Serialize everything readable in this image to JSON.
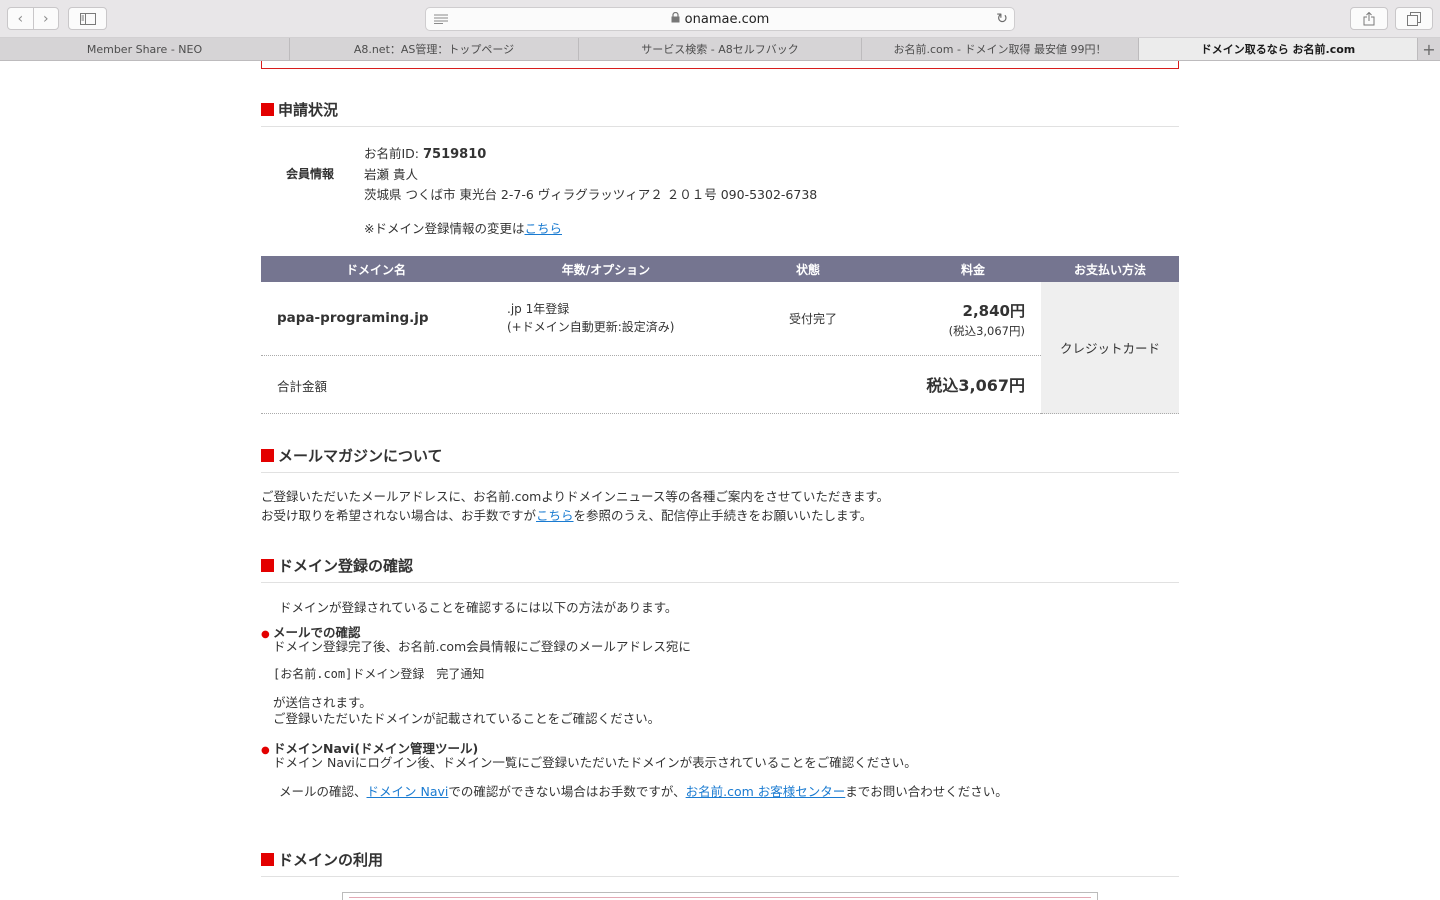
{
  "browser": {
    "url": "onamae.com",
    "tabs": [
      {
        "label": "Member Share - NEO"
      },
      {
        "label": "A8.net：AS管理：トップページ"
      },
      {
        "label": "サービス検索 - A8セルフバック"
      },
      {
        "label": "お名前.com - ドメイン取得 最安値 99円！"
      },
      {
        "label": "ドメイン取るなら お名前.com"
      }
    ]
  },
  "application": {
    "title": "申請状況",
    "member_label": "会員情報",
    "member_id_label": "お名前ID: ",
    "member_id": "7519810",
    "member_name": "岩瀬 貴人",
    "member_address": "茨城県 つくば市 東光台 2-7-6 ヴィラグラッツィア２ ２０１号 090-5302-6738",
    "change_note_prefix": "※ドメイン登録情報の変更は",
    "change_note_link": "こちら"
  },
  "table": {
    "headers": [
      "ドメイン名",
      "年数/オプション",
      "状態",
      "料金",
      "お支払い方法"
    ],
    "domain": "papa-programing.jp",
    "option_line1": ".jp 1年登録",
    "option_line2": "(+ドメイン自動更新:設定済み)",
    "status": "受付完了",
    "price": "2,840円",
    "price_tax": "(税込3,067円)",
    "payment": "クレジットカード",
    "total_label": "合計金額",
    "total_value": "税込3,067円"
  },
  "newsletter": {
    "title": "メールマガジンについて",
    "line1": "ご登録いただいたメールアドレスに、お名前.comよりドメインニュース等の各種ご案内をさせていただきます。",
    "line2_prefix": "お受け取りを希望されない場合は、お手数ですが",
    "line2_link": "こちら",
    "line2_suffix": "を参照のうえ、配信停止手続きをお願いいたします。"
  },
  "confirm": {
    "title": "ドメイン登録の確認",
    "intro": "ドメインが登録されていることを確認するには以下の方法があります。",
    "mail_title": "メールでの確認",
    "mail_line1": "ドメイン登録完了後、お名前.com会員情報にご登録のメールアドレス宛に",
    "mail_subject": "[お名前.com]ドメイン登録　完了通知",
    "mail_line2": "が送信されます。",
    "mail_line3": "ご登録いただいたドメインが記載されていることをご確認ください。",
    "navi_title": "ドメインNavi(ドメイン管理ツール)",
    "navi_line": "ドメイン Naviにログイン後、ドメイン一覧にご登録いただいたドメインが表示されていることをご確認ください。",
    "contact_prefix": "メールの確認、",
    "contact_link1": "ドメイン Navi",
    "contact_mid": "での確認ができない場合はお手数ですが、",
    "contact_link2": "お名前.com お客様センター",
    "contact_suffix": "までお問い合わせください。"
  },
  "usage": {
    "title": "ドメインの利用"
  }
}
